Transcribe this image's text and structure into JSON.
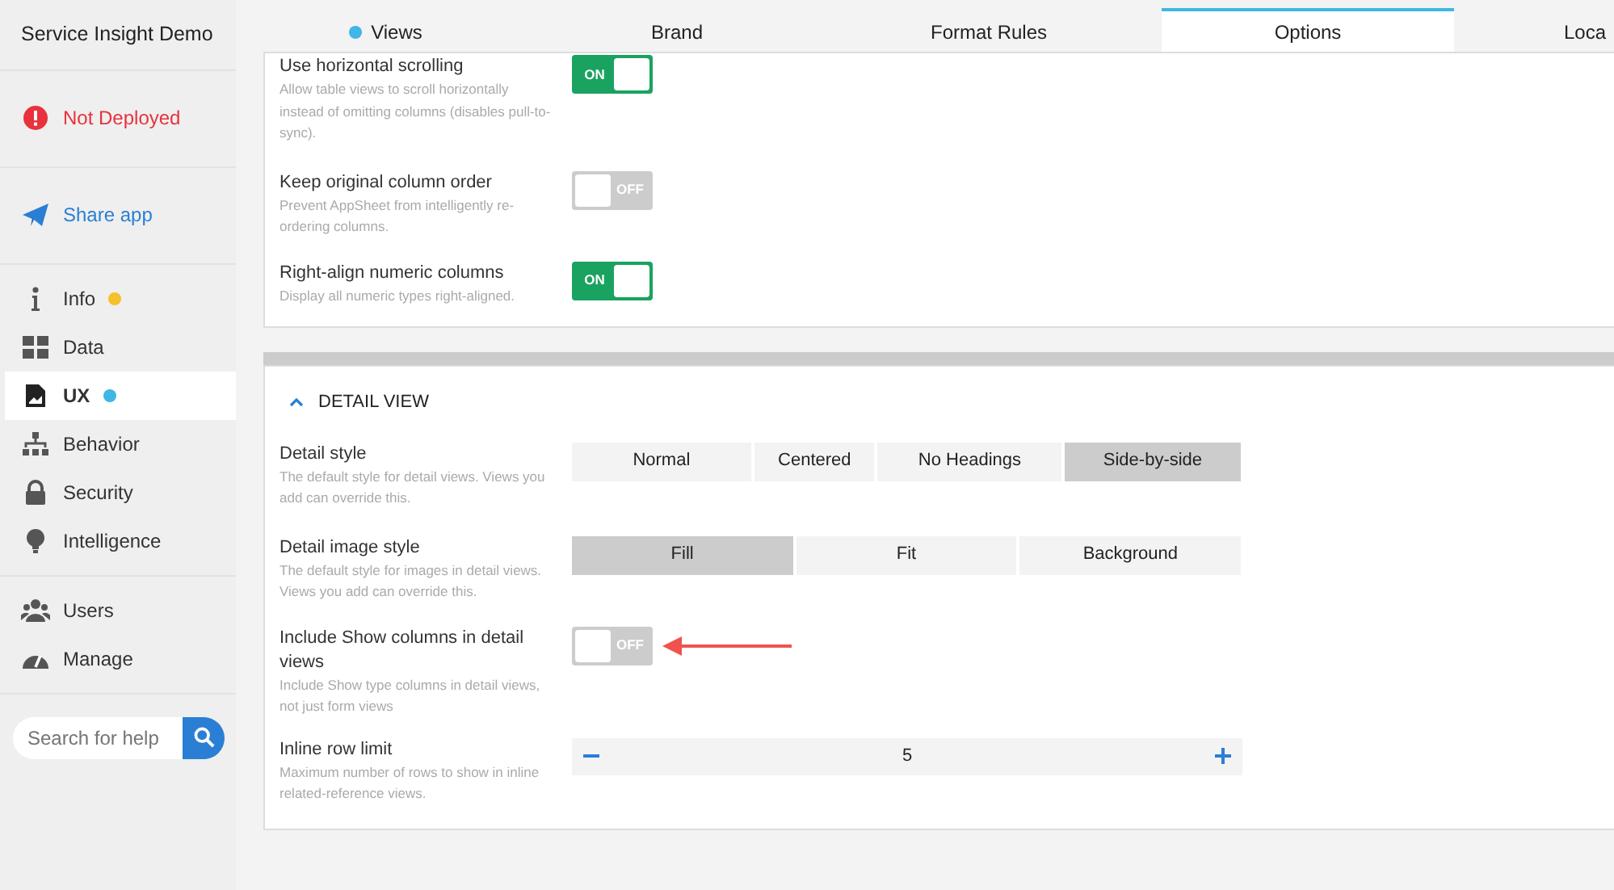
{
  "sidebar": {
    "title": "Service Insight Demo",
    "groups": [
      [
        {
          "label": "Not Deployed",
          "kind": "alert",
          "selected": false
        }
      ],
      [
        {
          "label": "Share app",
          "kind": "share",
          "selected": false
        }
      ],
      [
        {
          "label": "Info",
          "kind": "info",
          "selected": false,
          "color": "#f5c02a"
        },
        {
          "label": "Data",
          "kind": "data",
          "selected": false
        },
        {
          "label": "UX",
          "kind": "ux",
          "selected": true,
          "color": "#3fb6e6"
        },
        {
          "label": "Behavior",
          "kind": "behavior",
          "selected": false
        },
        {
          "label": "Security",
          "kind": "security",
          "selected": false
        },
        {
          "label": "Intelligence",
          "kind": "intelligence",
          "selected": false
        }
      ],
      [
        {
          "label": "Users",
          "kind": "users",
          "selected": false
        },
        {
          "label": "Manage",
          "kind": "manage",
          "selected": false
        }
      ]
    ],
    "search": {
      "placeholder": "Search for help"
    }
  },
  "tabs": [
    {
      "label": "Views",
      "selected": false,
      "color": "#3fb6e6"
    },
    {
      "label": "Brand",
      "selected": false
    },
    {
      "label": "Format Rules",
      "selected": false
    },
    {
      "label": "Options",
      "selected": true
    },
    {
      "label": "Loca",
      "selected": false
    }
  ],
  "sections": [
    {
      "rows": [
        {
          "kind": "toggle",
          "label": "Use horizontal scrolling",
          "description": "Allow table views to scroll horizontally instead of omitting columns (disables pull-to-sync).",
          "on": true,
          "text": "ON"
        },
        {
          "kind": "toggle",
          "label": "Keep original column order",
          "description": "Prevent AppSheet from intelligently re-ordering columns.",
          "on": false,
          "text": "OFF"
        },
        {
          "kind": "toggle",
          "label": "Right-align numeric columns",
          "description": "Display all numeric types right-aligned.",
          "on": true,
          "text": "ON"
        }
      ]
    },
    {
      "title": "DETAIL VIEW",
      "expanded": true,
      "rows": [
        {
          "kind": "segmented",
          "label": "Detail style",
          "description": "The default style for detail views. Views you add can override this.",
          "options": [
            {
              "label": "Normal",
              "selected": false
            },
            {
              "label": "Centered",
              "selected": false
            },
            {
              "label": "No Headings",
              "selected": false
            },
            {
              "label": "Side-by-side",
              "selected": true
            }
          ]
        },
        {
          "kind": "segmented",
          "label": "Detail image style",
          "description": "The default style for images in detail views. Views you add can override this.",
          "options": [
            {
              "label": "Fill",
              "selected": true
            },
            {
              "label": "Fit",
              "selected": false
            },
            {
              "label": "Background",
              "selected": false
            }
          ]
        },
        {
          "kind": "toggle",
          "label": "Include Show columns in detail views",
          "description": "Include Show type columns in detail views, not just form views",
          "on": false,
          "text": "OFF",
          "annotated": true
        },
        {
          "kind": "stepper",
          "label": "Inline row limit",
          "description": "Maximum number of rows to show in inline related-reference views.",
          "value": "5"
        }
      ]
    }
  ]
}
